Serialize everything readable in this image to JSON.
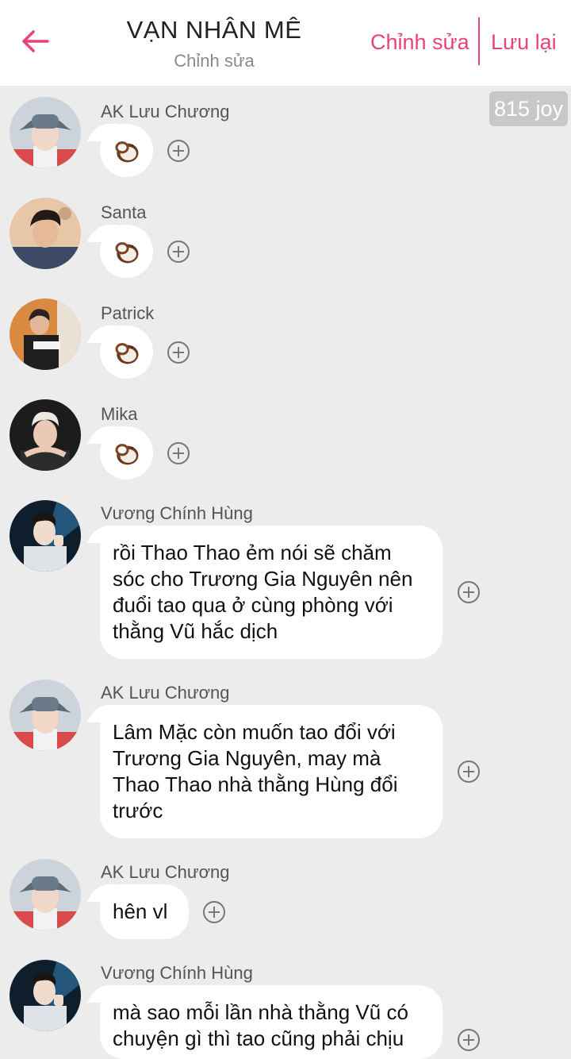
{
  "header": {
    "title": "VẠN NHÂN MÊ",
    "subtitle": "Chỉnh sửa",
    "edit_label": "Chỉnh sửa",
    "save_label": "Lưu lại",
    "accent_color": "#e8437c"
  },
  "joy_badge": "815 joy",
  "messages": [
    {
      "name": "AK Lưu Chương",
      "reaction_icon": "coconut-icon",
      "avatar_icon": "avatar-bucket-hat"
    },
    {
      "name": "Santa",
      "reaction_icon": "coconut-icon",
      "avatar_icon": "avatar-dark-hair"
    },
    {
      "name": "Patrick",
      "reaction_icon": "coconut-icon",
      "avatar_icon": "avatar-black-jacket"
    },
    {
      "name": "Mika",
      "reaction_icon": "coconut-icon",
      "avatar_icon": "avatar-blonde-hair"
    },
    {
      "name": "Vương Chính Hùng",
      "text": "rồi Thao Thao ẻm nói sẽ chăm\nsóc cho Trương Gia Nguyên nên\nđuổi tao qua ở cùng phòng với\nthằng Vũ hắc dịch",
      "avatar_icon": "avatar-stage-light"
    },
    {
      "name": "AK Lưu Chương",
      "text": "Lâm Mặc còn muốn tao đổi với\nTrương Gia Nguyên, may mà\nThao Thao nhà thằng Hùng đổi\ntrước",
      "avatar_icon": "avatar-bucket-hat"
    },
    {
      "name": "AK Lưu Chương",
      "text": "hên vl",
      "avatar_icon": "avatar-bucket-hat"
    },
    {
      "name": "Vương Chính Hùng",
      "text": "mà sao mỗi lần nhà thằng Vũ có\nchuyện gì thì tao cũng phải chịu",
      "avatar_icon": "avatar-stage-light"
    }
  ]
}
